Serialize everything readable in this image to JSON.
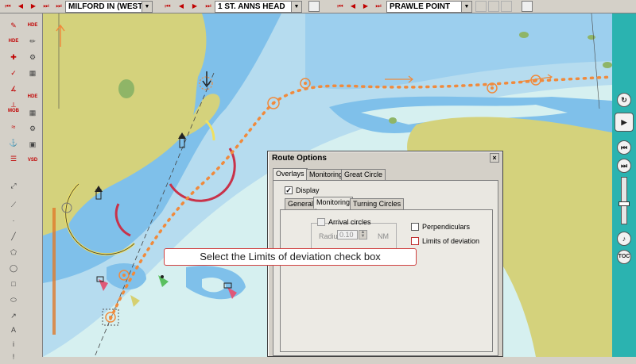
{
  "toolbar": {
    "combo1": "MILFORD IN (WEST)",
    "combo2": "1 ST. ANNS HEAD",
    "combo3": "PRAWLE POINT"
  },
  "left_tools": {
    "hde_label": "HDE",
    "mob_label": "MOB",
    "vsd_label": "VSD"
  },
  "right_panel": {
    "toc_label": "TOC"
  },
  "dialog": {
    "title": "Route Options",
    "tabs": [
      "Overlays",
      "Monitoring",
      "Great Circle"
    ],
    "display_label": "Display",
    "display_checked": true,
    "subtabs": [
      "General",
      "Monitoring",
      "Turning Circles"
    ],
    "arrival_circles_label": "Arrival circles",
    "radius_label": "Radius",
    "radius_value": "0.10",
    "radius_unit": "NM",
    "perpendiculars_label": "Perpendiculars",
    "limits_label": "Limits of deviation"
  },
  "callout": {
    "text": "Select the Limits of deviation check box"
  },
  "colors": {
    "land": "#d4d27c",
    "shallow": "#7fc0ea",
    "mid": "#b6dcef",
    "deep": "#d6f0f0",
    "route": "#f08a3c",
    "accent_right": "#2bb3b0"
  }
}
